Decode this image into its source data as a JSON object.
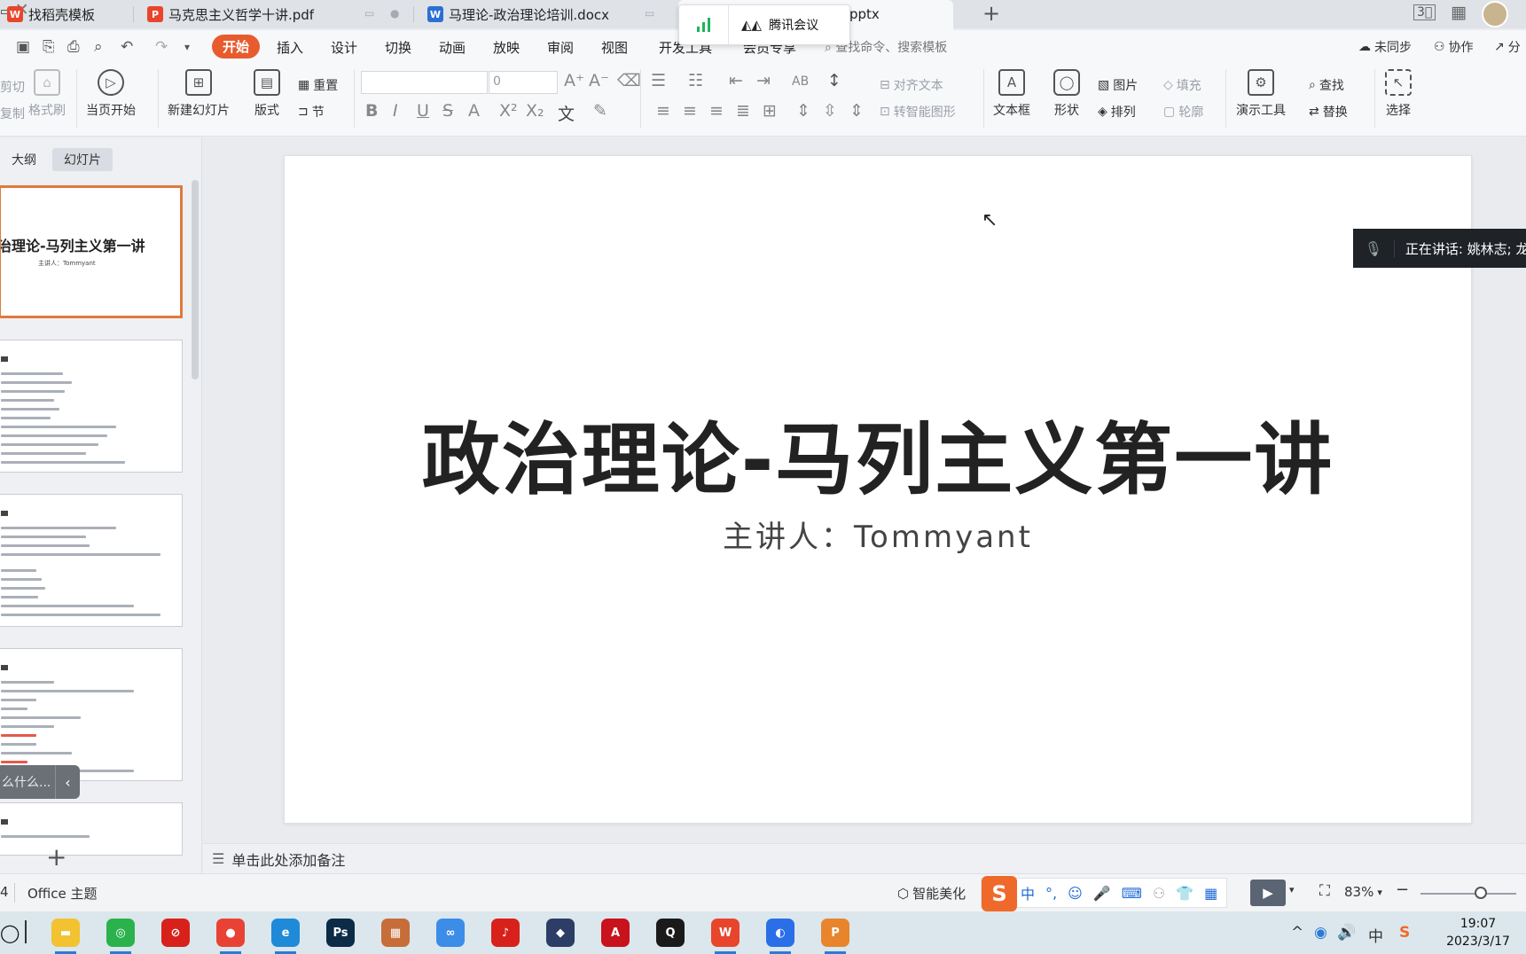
{
  "tabs": [
    {
      "label": "找稻壳模板",
      "color": "#e8452c",
      "glyph": "W"
    },
    {
      "label": "马克思主义哲学十讲.pdf",
      "color": "#e8452c",
      "glyph": "P"
    },
    {
      "label": "马理论-政治理论培训.docx",
      "color": "#2b6fd6",
      "glyph": "W"
    },
    {
      "label": "pptx",
      "color": "#e8652c",
      "glyph": "P"
    }
  ],
  "meeting_popup": {
    "label": "腾讯会议"
  },
  "menu": {
    "start": "开始",
    "items": [
      "插入",
      "设计",
      "切换",
      "动画",
      "放映",
      "审阅",
      "视图",
      "开发工具",
      "会员专享"
    ],
    "search": "查找命令、搜索模板",
    "right": [
      "未同步",
      "协作",
      "分"
    ]
  },
  "ribbon": {
    "cut": "剪切",
    "copy": "复制",
    "format_painter": "格式刷",
    "play_current": "当页开始",
    "new_slide": "新建幻灯片",
    "layout": "版式",
    "reset": "重置",
    "section": "节",
    "font_size": "0",
    "align_text": "对齐文本",
    "smartart": "转智能图形",
    "textbox": "文本框",
    "shape": "形状",
    "picture": "图片",
    "arrange": "排列",
    "fill": "填充",
    "outline": "轮廓",
    "present_tools": "演示工具",
    "find": "查找",
    "replace": "替换",
    "select": "选择"
  },
  "left_panel": {
    "tab_outline": "大纲",
    "tab_slides": "幻灯片",
    "thumb1_title": "治理论-马列主义第一讲",
    "thumb1_sub": "主讲人：Tommyant",
    "tooltip_text": "么什么..."
  },
  "slide": {
    "title": "政治理论-马列主义第一讲",
    "subtitle": "主讲人：Tommyant"
  },
  "speaking_banner": "正在讲话: 姚林志; 龙",
  "notes_placeholder": "单击此处添加备注",
  "statusbar": {
    "page": "4",
    "theme": "Office 主题",
    "beautify": "智能美化",
    "ime_mode": "中",
    "zoom": "83%"
  },
  "clock": {
    "time": "19:07",
    "date": "2023/3/17"
  },
  "taskbar_apps": [
    {
      "name": "file-explorer",
      "color": "#f2c230",
      "glyph": "▬"
    },
    {
      "name": "wechat",
      "color": "#2bb24c",
      "glyph": "◎"
    },
    {
      "name": "red-app",
      "color": "#d8211b",
      "glyph": "⊘"
    },
    {
      "name": "chrome",
      "color": "#e94235",
      "glyph": "●"
    },
    {
      "name": "edge",
      "color": "#1f8ad8",
      "glyph": "e"
    },
    {
      "name": "photoshop",
      "color": "#0b2b47",
      "glyph": "Ps"
    },
    {
      "name": "image-viewer",
      "color": "#c76d3a",
      "glyph": "▦"
    },
    {
      "name": "baidu-pan",
      "color": "#3b8de8",
      "glyph": "∞"
    },
    {
      "name": "netease-music",
      "color": "#d8211b",
      "glyph": "♪"
    },
    {
      "name": "cat-app",
      "color": "#2c3e66",
      "glyph": "◆"
    },
    {
      "name": "autocad",
      "color": "#c8121c",
      "glyph": "A"
    },
    {
      "name": "qq",
      "color": "#1a1a1a",
      "glyph": "Q"
    },
    {
      "name": "wps",
      "color": "#e8452c",
      "glyph": "W"
    },
    {
      "name": "tencent-meeting",
      "color": "#2a6ee8",
      "glyph": "◐"
    },
    {
      "name": "wps-present",
      "color": "#e8852c",
      "glyph": "P"
    }
  ]
}
